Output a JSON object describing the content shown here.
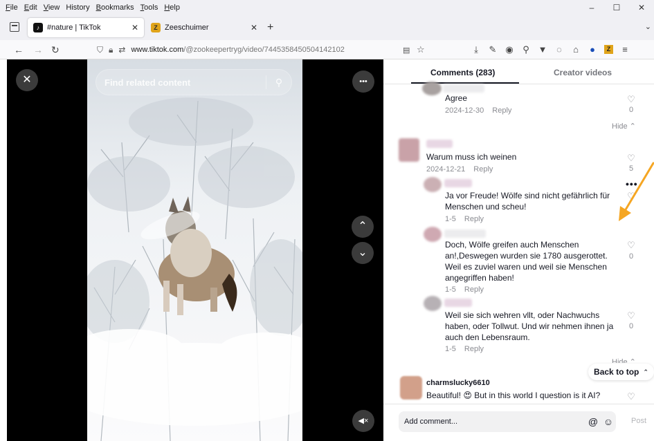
{
  "menubar": {
    "items": [
      {
        "label": "File",
        "key": "F",
        "rest": "ile"
      },
      {
        "label": "Edit",
        "key": "E",
        "rest": "dit"
      },
      {
        "label": "View",
        "key": "V",
        "rest": "iew"
      },
      {
        "label": "History",
        "key": "",
        "rest": "History"
      },
      {
        "label": "Bookmarks",
        "key": "B",
        "rest": "ookmarks"
      },
      {
        "label": "Tools",
        "key": "T",
        "rest": "ools"
      },
      {
        "label": "Help",
        "key": "H",
        "rest": "elp"
      }
    ],
    "minimize": "–",
    "maximize": "☐",
    "close": "✕"
  },
  "tabs": [
    {
      "title": "#nature | TikTok",
      "favicon": "tiktok-logo",
      "close": "✕"
    },
    {
      "title": "Zeeschuimer",
      "favicon": "zeeschuimer-logo",
      "close": "✕"
    }
  ],
  "newtab": "+",
  "tabs_overflow": "⌄",
  "nav": {
    "back": "←",
    "forward": "→",
    "reload": "↻"
  },
  "url": {
    "host": "www.tiktok.com",
    "path": "/@zookeepertryg/video/7445358450504142102"
  },
  "toolbar_icons": [
    "download-icon",
    "tools-icon",
    "account-icon",
    "extensions-icon",
    "pocket-icon",
    "ghostery-icon",
    "library-icon",
    "ublock-icon",
    "zeeschuimer-icon",
    "menu-icon"
  ],
  "player": {
    "search_placeholder": "Find related content",
    "close": "✕",
    "more": "•••",
    "prev": "⌃",
    "next": "⌄",
    "mute": "◀×"
  },
  "panel": {
    "tab_comments": "Comments (283)",
    "tab_creator": "Creator videos",
    "comments": [
      {
        "text": "Agree",
        "date": "2024-12-30",
        "reply": "Reply",
        "likes": "0"
      },
      {
        "hide": "Hide ⌃"
      },
      {
        "text": "Warum muss ich weinen",
        "date": "2024-12-21",
        "reply": "Reply",
        "likes": "5"
      },
      {
        "text": "Ja vor Freude! Wölfe sind nicht gefährlich für Menschen und scheu!",
        "date": "1-5",
        "reply": "Reply"
      },
      {
        "text": "Doch, Wölfe greifen auch Menschen an!,Deswegen wurden sie 1780 ausgerottet. Weil es zuviel waren und weil sie Menschen angegriffen haben!",
        "date": "1-5",
        "reply": "Reply",
        "likes": "0"
      },
      {
        "text": "Weil sie sich wehren vllt, oder Nachwuchs haben, oder Tollwut. Und wir nehmen ihnen ja auch den Lebensraum.",
        "date": "1-5",
        "reply": "Reply",
        "likes": "0"
      },
      {
        "hide": "Hide ⌃"
      },
      {
        "user": "charmslucky6610",
        "text": "Beautiful! 😍 But in this world I question is it AI?"
      }
    ],
    "more_dots": "•••",
    "back_to_top": "Back to top",
    "back_to_top_icon": "⌃⌃",
    "add_comment_placeholder": "Add comment...",
    "mention_icon": "@",
    "emoji_icon": "☺",
    "post": "Post"
  },
  "colors": {
    "accent_arrow": "#f5a623",
    "tiktok_text": "#161823",
    "muted": "#8a8b91"
  }
}
